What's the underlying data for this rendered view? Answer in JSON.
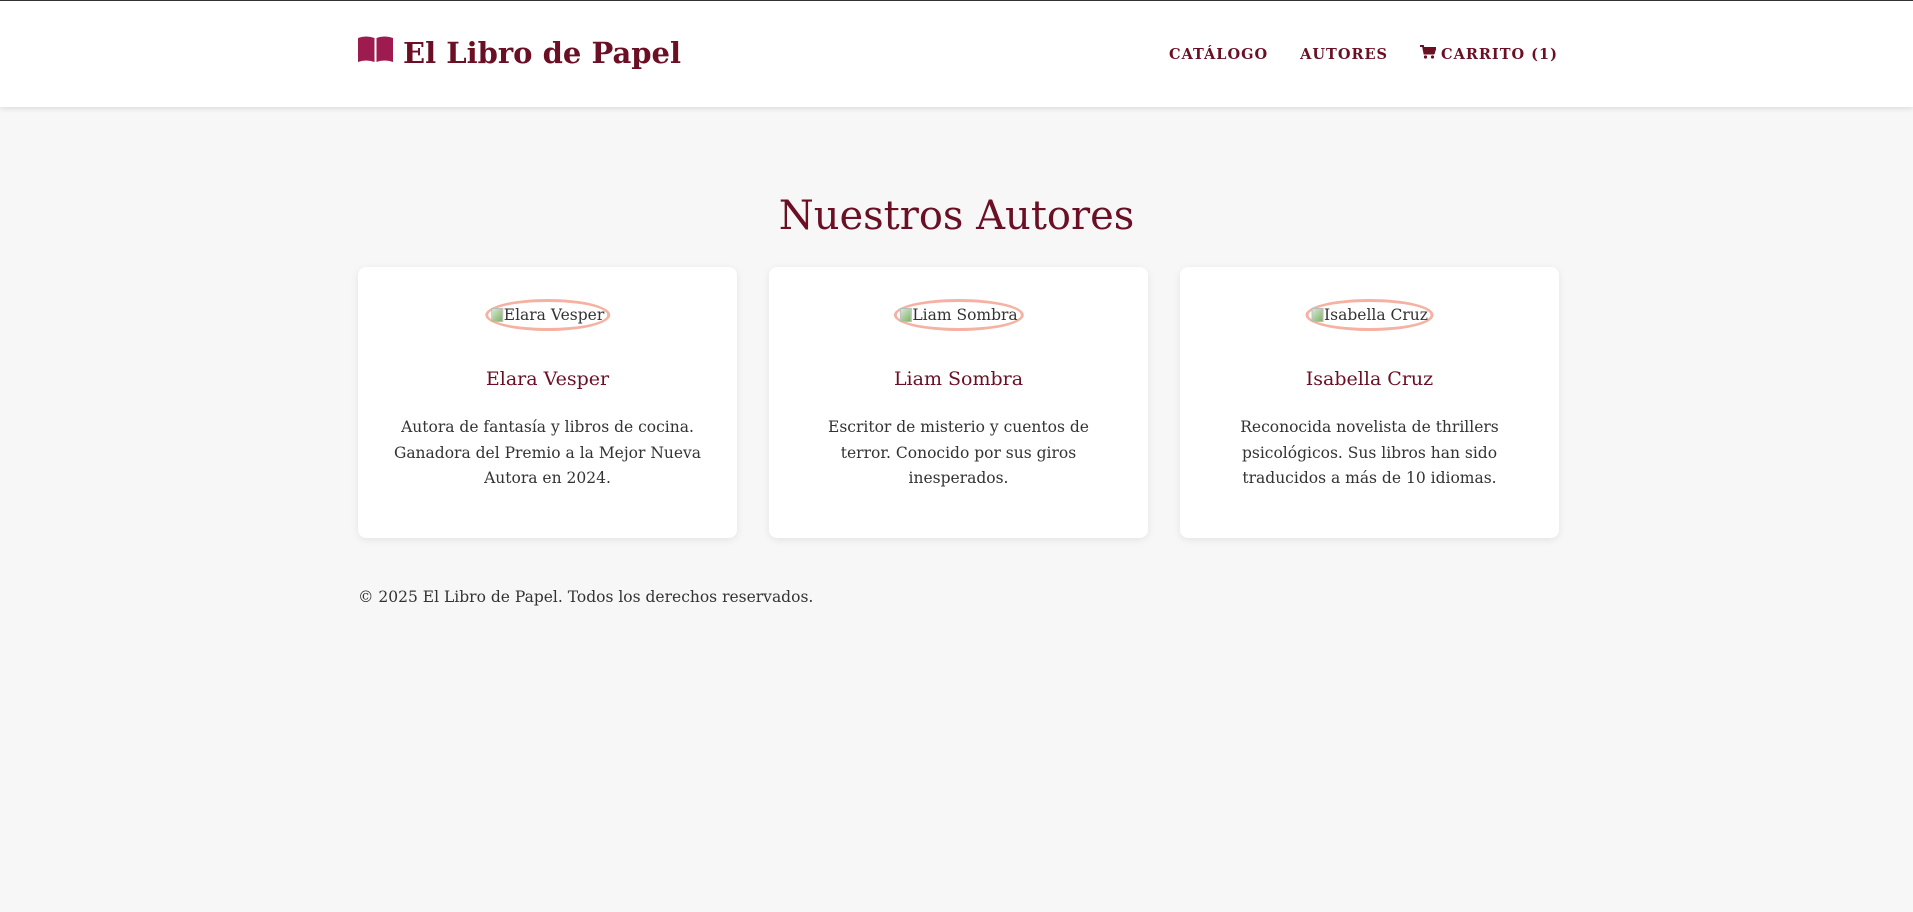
{
  "header": {
    "logo_text": "El Libro de Papel",
    "logo_icon": "book-open-icon",
    "nav": [
      {
        "label": "CATÁLOGO"
      },
      {
        "label": "AUTORES"
      },
      {
        "label": "CARRITO (1)",
        "icon": "cart-icon"
      }
    ]
  },
  "main": {
    "title": "Nuestros Autores",
    "authors": [
      {
        "image_alt": "Elara Vesper",
        "name": "Elara Vesper",
        "bio": "Autora de fantasía y libros de cocina. Ganadora del Premio a la Mejor Nueva Autora en 2024."
      },
      {
        "image_alt": "Liam Sombra",
        "name": "Liam Sombra",
        "bio": "Escritor de misterio y cuentos de terror. Conocido por sus giros inesperados."
      },
      {
        "image_alt": "Isabella Cruz",
        "name": "Isabella Cruz",
        "bio": "Reconocida novelista de thrillers psicológicos. Sus libros han sido traducidos a más de 10 idiomas."
      }
    ]
  },
  "footer": {
    "text": "© 2025 El Libro de Papel. Todos los derechos reservados."
  },
  "colors": {
    "brand": "#6b0f24",
    "accent": "#9e1b4f",
    "avatar_border": "#f5b2a3",
    "background": "#f7f7f7"
  }
}
